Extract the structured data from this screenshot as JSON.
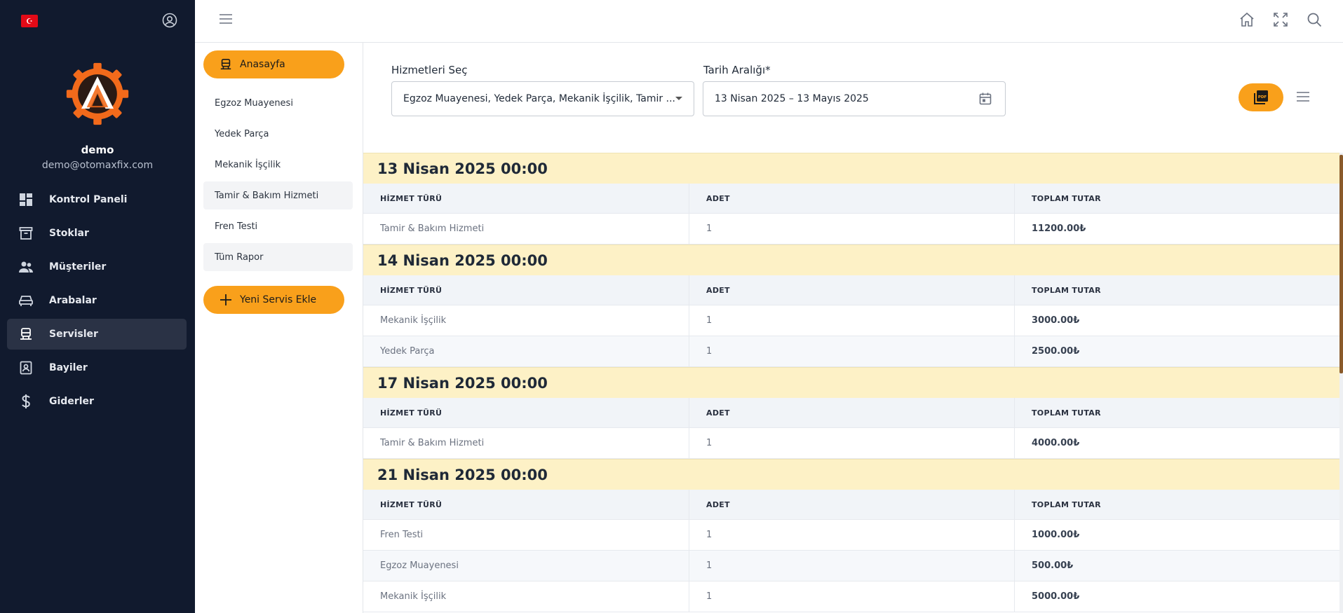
{
  "sidebar": {
    "flag_glyph": "☪",
    "user": {
      "name": "demo",
      "email": "demo@otomaxfix.com"
    },
    "items": [
      {
        "label": "Kontrol Paneli",
        "icon": "dashboard-icon",
        "active": false
      },
      {
        "label": "Stoklar",
        "icon": "archive-icon",
        "active": false
      },
      {
        "label": "Müşteriler",
        "icon": "users-icon",
        "active": false
      },
      {
        "label": "Arabalar",
        "icon": "car-icon",
        "active": false
      },
      {
        "label": "Servisler",
        "icon": "service-icon",
        "active": true
      },
      {
        "label": "Bayiler",
        "icon": "dealer-icon",
        "active": false
      },
      {
        "label": "Giderler",
        "icon": "dollar-icon",
        "active": false
      }
    ]
  },
  "subpanel": {
    "home_button": "Anasayfa",
    "items": [
      {
        "label": "Egzoz Muayenesi"
      },
      {
        "label": "Yedek Parça"
      },
      {
        "label": "Mekanik İşçilik"
      },
      {
        "label": "Tamir & Bakım Hizmeti"
      },
      {
        "label": "Fren Testi"
      },
      {
        "label": "Tüm Rapor"
      }
    ],
    "add_button": "Yeni Servis Ekle"
  },
  "filters": {
    "services_label": "Hizmetleri Seç",
    "services_value": "Egzoz Muayenesi, Yedek Parça, Mekanik İşçilik, Tamir ...",
    "date_label": "Tarih Aralığı*",
    "date_value": "13 Nisan 2025 – 13 Mayıs 2025"
  },
  "table": {
    "headers": [
      "HİZMET TÜRÜ",
      "ADET",
      "TOPLAM TUTAR"
    ],
    "groups": [
      {
        "date": "13 Nisan 2025 00:00",
        "rows": [
          {
            "service": "Tamir & Bakım Hizmeti",
            "qty": "1",
            "total": "11200.00₺"
          }
        ]
      },
      {
        "date": "14 Nisan 2025 00:00",
        "rows": [
          {
            "service": "Mekanik İşçilik",
            "qty": "1",
            "total": "3000.00₺"
          },
          {
            "service": "Yedek Parça",
            "qty": "1",
            "total": "2500.00₺"
          }
        ]
      },
      {
        "date": "17 Nisan 2025 00:00",
        "rows": [
          {
            "service": "Tamir & Bakım Hizmeti",
            "qty": "1",
            "total": "4000.00₺"
          }
        ]
      },
      {
        "date": "21 Nisan 2025 00:00",
        "rows": [
          {
            "service": "Fren Testi",
            "qty": "1",
            "total": "1000.00₺"
          },
          {
            "service": "Egzoz Muayenesi",
            "qty": "1",
            "total": "500.00₺"
          },
          {
            "service": "Mekanik İşçilik",
            "qty": "1",
            "total": "5000.00₺"
          }
        ]
      }
    ]
  },
  "colors": {
    "accent": "#f9a01b",
    "sidebar_bg": "#111a2e",
    "day_header_bg": "#fdf1c6"
  }
}
